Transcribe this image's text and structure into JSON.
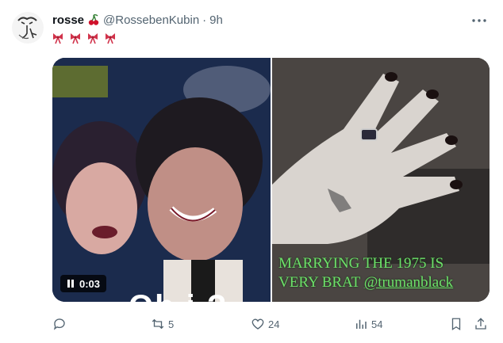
{
  "tweet": {
    "display_name": "rosse",
    "handle": "@RossebenKubin",
    "separator": "·",
    "time": "9h",
    "text_icons": [
      "bow-icon",
      "bow-icon",
      "bow-icon"
    ]
  },
  "media": {
    "video_time": "0:03",
    "overlay_text": "Oh i  ?",
    "caption_line1": "MARRYING THE 1975 IS",
    "caption_line2_prefix": "VERY BRAT ",
    "caption_line2_handle": "@trumanblack"
  },
  "actions": {
    "reply_count": "",
    "repost_count": "5",
    "like_count": "24",
    "views_count": "54"
  },
  "colors": {
    "accent_caption": "#6ee06a",
    "text_secondary": "#536471",
    "text_primary": "#0f1419"
  },
  "icons": {
    "avatar": "avatar-sketch",
    "more": "more-icon",
    "reply": "reply-icon",
    "repost": "repost-icon",
    "like": "heart-icon",
    "views": "views-icon",
    "bookmark": "bookmark-icon",
    "share": "share-icon",
    "play": "pause-icon",
    "cherry": "cherry-icon"
  }
}
